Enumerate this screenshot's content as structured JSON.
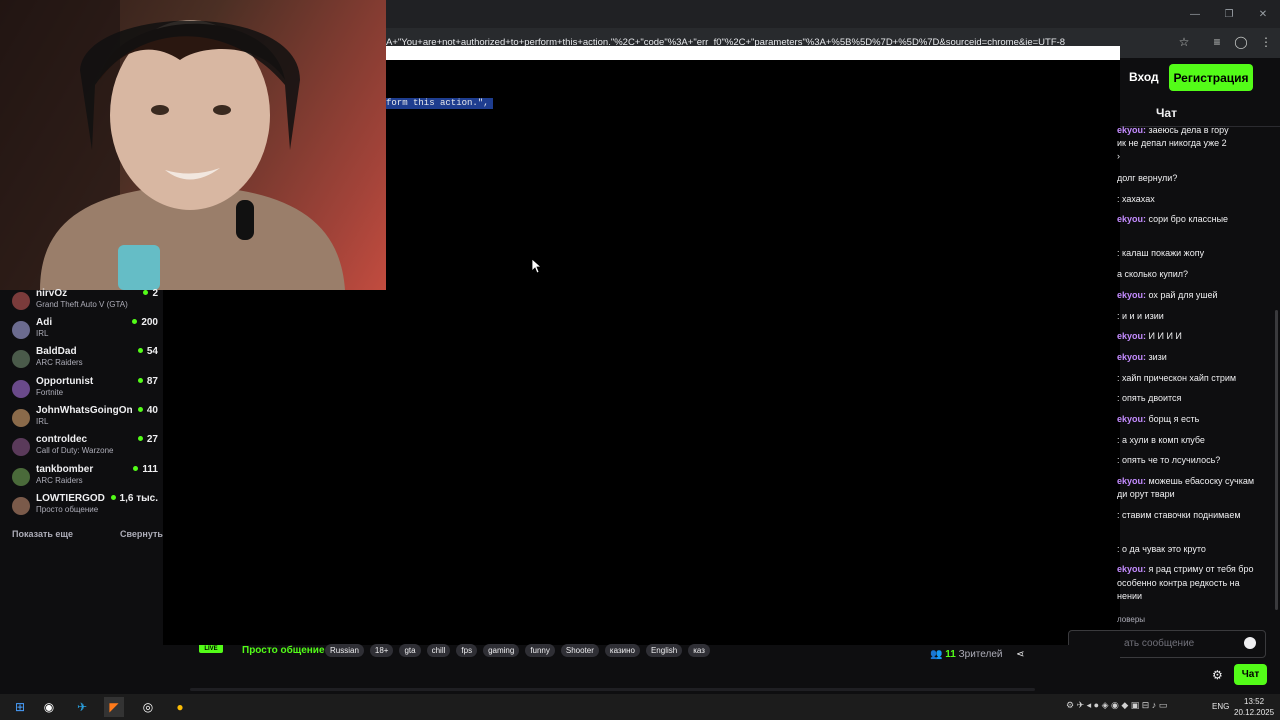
{
  "browser": {
    "url_fragment": "A+\"You+are+not+authorized+to+perform+this+action.\"%2C+\"code\"%3A+\"err_f0\"%2C+\"parameters\"%3A+%5B%5D%7D+%5D%7D&sourceid=chrome&ie=UTF-8"
  },
  "error_page": {
    "selected_text": "form this action.\","
  },
  "header": {
    "login_label": "Вход",
    "register_label": "Регистрация"
  },
  "sidebar": {
    "channels": [
      {
        "name": "nirvOz",
        "game": "Grand Theft Auto V (GTA)",
        "viewers": "2",
        "avatar": "#7a3b3b"
      },
      {
        "name": "Adi",
        "game": "IRL",
        "viewers": "200",
        "avatar": "#6b6b8f"
      },
      {
        "name": "BaldDad",
        "game": "ARC Raiders",
        "viewers": "54",
        "avatar": "#4a5a4a"
      },
      {
        "name": "Opportunist",
        "game": "Fortnite",
        "viewers": "87",
        "avatar": "#6a4a8a"
      },
      {
        "name": "JohnWhatsGoingOn",
        "game": "IRL",
        "viewers": "40",
        "avatar": "#8a6a4a"
      },
      {
        "name": "controldec",
        "game": "Call of Duty: Warzone",
        "viewers": "27",
        "avatar": "#5a3a5a"
      },
      {
        "name": "tankbomber",
        "game": "ARC Raiders",
        "viewers": "111",
        "avatar": "#4a6a3a"
      },
      {
        "name": "LOWTIERGOD",
        "game": "Просто общение",
        "viewers": "1,6 тыс.",
        "avatar": "#7a5a4a"
      }
    ],
    "show_more": "Показать еще",
    "collapse": "Свернуть"
  },
  "chat": {
    "title": "Чат",
    "messages": [
      {
        "user": "ekyou:",
        "text": " заеюсь дела в гору"
      },
      {
        "user": "",
        "text": "ик не депал никогда уже 2"
      },
      {
        "user": "",
        "text": "›"
      },
      {
        "user": "",
        "text": "долг вернули?"
      },
      {
        "user": "",
        "text": ": хахахах"
      },
      {
        "user": "ekyou:",
        "text": " сори бро классные"
      },
      {
        "user": "",
        "text": ": калаш покажи жопу"
      },
      {
        "user": "",
        "text": "а сколько купил?"
      },
      {
        "user": "ekyou:",
        "text": " ох рай для ушей"
      },
      {
        "user": "",
        "text": ": и и и изии"
      },
      {
        "user": "ekyou:",
        "text": " И И И И"
      },
      {
        "user": "ekyou:",
        "text": " зизи"
      },
      {
        "user": "",
        "text": ": хайп прическон хайп стрим"
      },
      {
        "user": "",
        "text": ": опять двоится"
      },
      {
        "user": "ekyou:",
        "text": " борщ я есть"
      },
      {
        "user": "",
        "text": ": а хули в комп клубе"
      },
      {
        "user": "",
        "text": ": опять че то лсучилось?"
      },
      {
        "user": "ekyou:",
        "text": " можешь ебасоску сучкам"
      },
      {
        "user": "",
        "text": "ди орут твари"
      },
      {
        "user": "",
        "text": ": ставим ставочки поднимаем"
      },
      {
        "user": "",
        "text": ": о да чувак это круто"
      },
      {
        "user": "ekyou:",
        "text": " я рад стриму от тебя бро"
      },
      {
        "user": "",
        "text": "особенно контра редкость на"
      },
      {
        "user": "",
        "text": "нении"
      }
    ],
    "followers_label": "ловеры",
    "input_placeholder": "ать сообщение",
    "send_label": "Чат"
  },
  "stream": {
    "live_label": "LIVE",
    "category": "Просто общение",
    "tags": [
      "Russian",
      "18+",
      "gta",
      "chill",
      "fps",
      "gaming",
      "funny",
      "Shooter",
      "казино",
      "English",
      "каз"
    ],
    "viewer_count": "11",
    "viewers_label": "Зрителей"
  },
  "taskbar": {
    "lang": "ENG",
    "time": "13:52",
    "date": "20.12.2025"
  },
  "colors": {
    "accent": "#53fc18",
    "background": "#0e0e10",
    "username": "#c48cff"
  }
}
